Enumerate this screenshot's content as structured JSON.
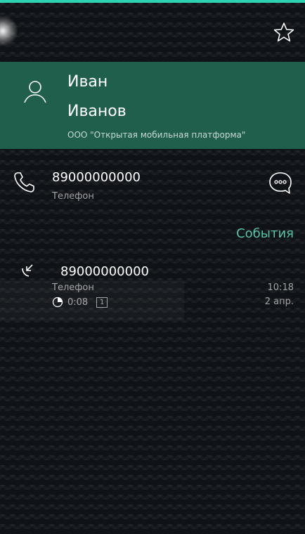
{
  "contact": {
    "first_name": "Иван",
    "last_name": "Иванов",
    "company": "ООО \"Открытая мобильная платформа\""
  },
  "phone": {
    "number": "89000000000",
    "label": "Телефон"
  },
  "events": {
    "header": "События",
    "items": [
      {
        "number": "89000000000",
        "label": "Телефон",
        "duration": "0:08",
        "sim": "1",
        "time": "10:18",
        "date": "2 апр."
      }
    ]
  },
  "icons": {
    "favorite": "star-icon",
    "avatar": "person-icon",
    "phone": "phone-icon",
    "message": "message-icon",
    "call_type": "outgoing-call-icon",
    "duration": "timer-icon"
  },
  "colors": {
    "accent": "#2fd1b0",
    "card": "#1f5f4c",
    "events_header": "#59c3a7"
  }
}
